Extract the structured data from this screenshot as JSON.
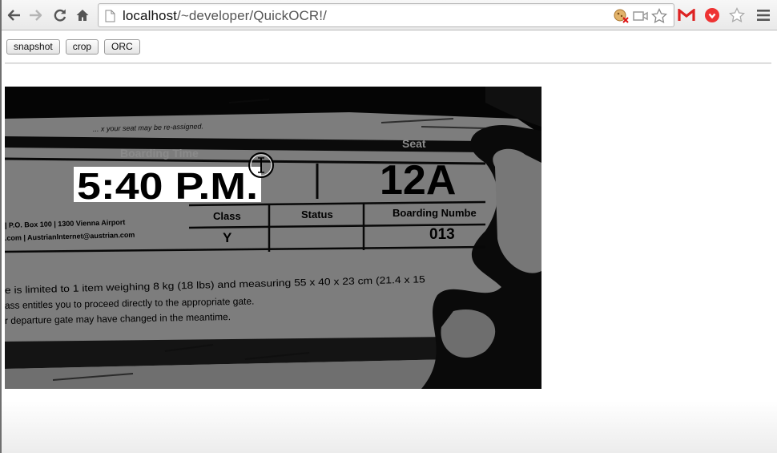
{
  "browser": {
    "url_host": "localhost",
    "url_path": "/~developer/QuickOCR!/"
  },
  "page": {
    "buttons": {
      "snapshot": "snapshot",
      "crop": "crop",
      "orc": "ORC"
    }
  },
  "image": {
    "note_line": "... x your seat may be re-assigned.",
    "boarding_time_label": "Boarding Time",
    "boarding_time": "5:40 P.M.",
    "seat_label": "Seat",
    "seat": "12A",
    "class_label": "Class",
    "class_value": "Y",
    "status_label": "Status",
    "boarding_number_label": "Boarding Numbe",
    "boarding_number": "013",
    "address_1": "| P.O. Box 100 | 1300 Vienna Airport",
    "address_2": ".com | AustrianInternet@austrian.com",
    "info_1": "e is limited to 1 item weighing 8 kg (18 lbs) and measuring 55 x 40 x 23 cm (21.4 x 15",
    "info_2": "ass entitles you to proceed directly to the appropriate gate.",
    "info_3": "r departure gate may have changed in the meantime."
  }
}
